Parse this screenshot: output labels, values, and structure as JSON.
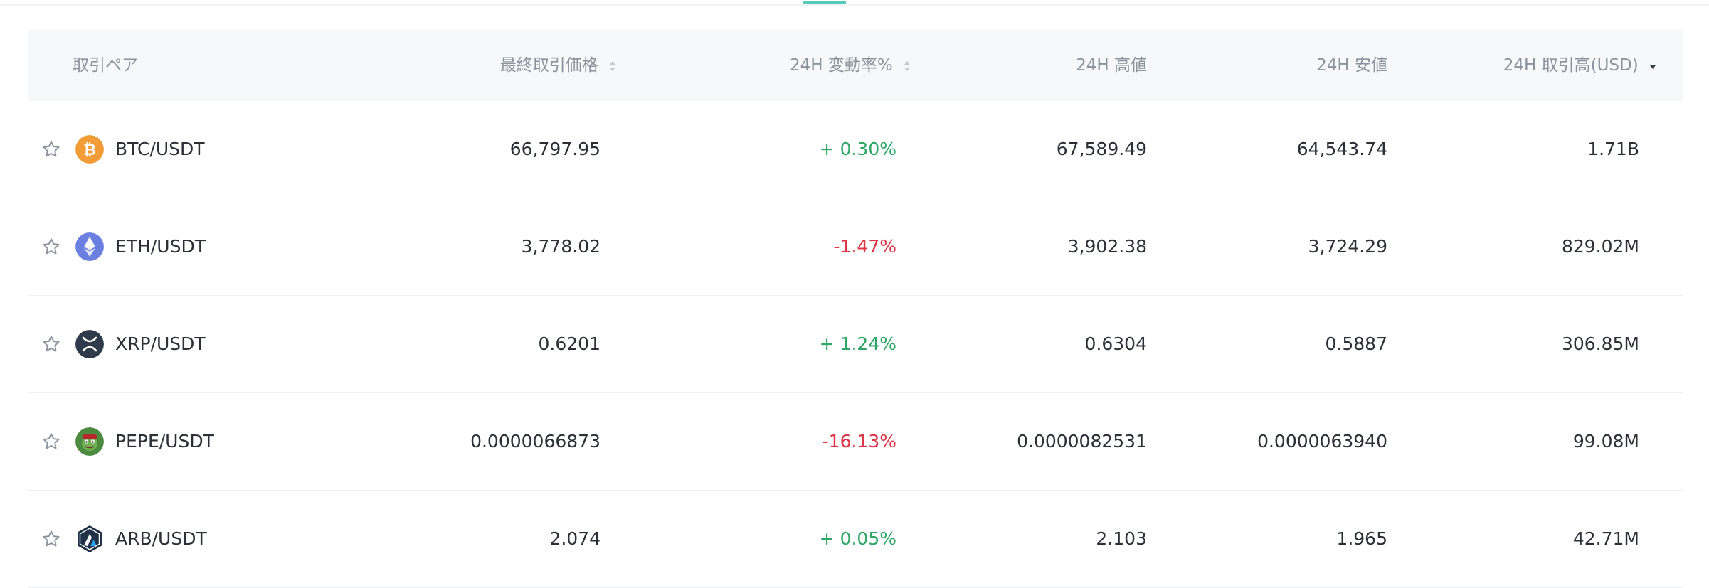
{
  "header": {
    "pair": "取引ペア",
    "last_price": "最終取引価格",
    "change": "24H 変動率%",
    "high": "24H 高値",
    "low": "24H 安値",
    "volume": "24H 取引高(USD)"
  },
  "icons": {
    "star": "star-outline-icon",
    "sort": "sort-updown-icon",
    "sort_active": "sort-down-icon"
  },
  "colors": {
    "positive": "#2ea665",
    "negative": "#dc3545",
    "accent": "#57c9b8"
  },
  "rows": [
    {
      "pair": "BTC/USDT",
      "coin": "btc-icon",
      "price": "66,797.95",
      "change": "+ 0.30%",
      "trend": "up",
      "high": "67,589.49",
      "low": "64,543.74",
      "volume": "1.71B"
    },
    {
      "pair": "ETH/USDT",
      "coin": "eth-icon",
      "price": "3,778.02",
      "change": "-1.47%",
      "trend": "down",
      "high": "3,902.38",
      "low": "3,724.29",
      "volume": "829.02M"
    },
    {
      "pair": "XRP/USDT",
      "coin": "xrp-icon",
      "price": "0.6201",
      "change": "+ 1.24%",
      "trend": "up",
      "high": "0.6304",
      "low": "0.5887",
      "volume": "306.85M"
    },
    {
      "pair": "PEPE/USDT",
      "coin": "pepe-icon",
      "price": "0.0000066873",
      "change": "-16.13%",
      "trend": "down",
      "high": "0.0000082531",
      "low": "0.0000063940",
      "volume": "99.08M"
    },
    {
      "pair": "ARB/USDT",
      "coin": "arb-icon",
      "price": "2.074",
      "change": "+ 0.05%",
      "trend": "up",
      "high": "2.103",
      "low": "1.965",
      "volume": "42.71M"
    }
  ]
}
